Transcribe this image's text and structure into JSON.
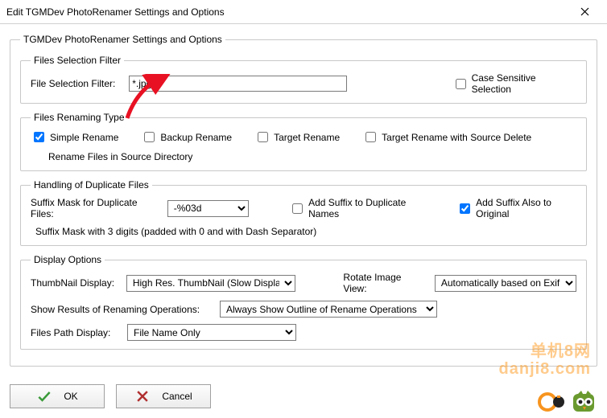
{
  "window": {
    "title": "Edit TGMDev PhotoRenamer Settings and Options"
  },
  "outerGroup": {
    "legend": "TGMDev PhotoRenamer Settings and Options"
  },
  "filter": {
    "legend": "Files Selection Filter",
    "label": "File Selection Filter:",
    "value": "*.jpg;",
    "caseSensitive": {
      "label": "Case Sensitive Selection",
      "checked": false
    }
  },
  "renameType": {
    "legend": "Files Renaming Type",
    "simple": {
      "label": "Simple Rename",
      "checked": true
    },
    "backup": {
      "label": "Backup Rename",
      "checked": false
    },
    "target": {
      "label": "Target Rename",
      "checked": false
    },
    "targetDel": {
      "label": "Target Rename with Source Delete",
      "checked": false
    },
    "note": "Rename Files in Source Directory"
  },
  "dup": {
    "legend": "Handling of Duplicate Files",
    "maskLabel": "Suffix Mask for Duplicate Files:",
    "maskValue": "-%03d",
    "addSuffix": {
      "label": "Add Suffix to Duplicate Names",
      "checked": false
    },
    "addAlsoOrig": {
      "label": "Add Suffix Also to Original",
      "checked": true
    },
    "note": "Suffix Mask with 3 digits (padded with 0 and with Dash Separator)"
  },
  "display": {
    "legend": "Display Options",
    "thumbLabel": "ThumbNail Display:",
    "thumbValue": "High Res. ThumbNail (Slow Display",
    "rotateLabel": "Rotate Image View:",
    "rotateValue": "Automatically based on Exif",
    "resultsLabel": "Show Results of Renaming Operations:",
    "resultsValue": "Always Show Outline of Rename Operations",
    "pathLabel": "Files Path Display:",
    "pathValue": "File Name Only"
  },
  "buttons": {
    "ok": "OK",
    "cancel": "Cancel"
  },
  "watermark": "单机8网\ndanji8.com"
}
